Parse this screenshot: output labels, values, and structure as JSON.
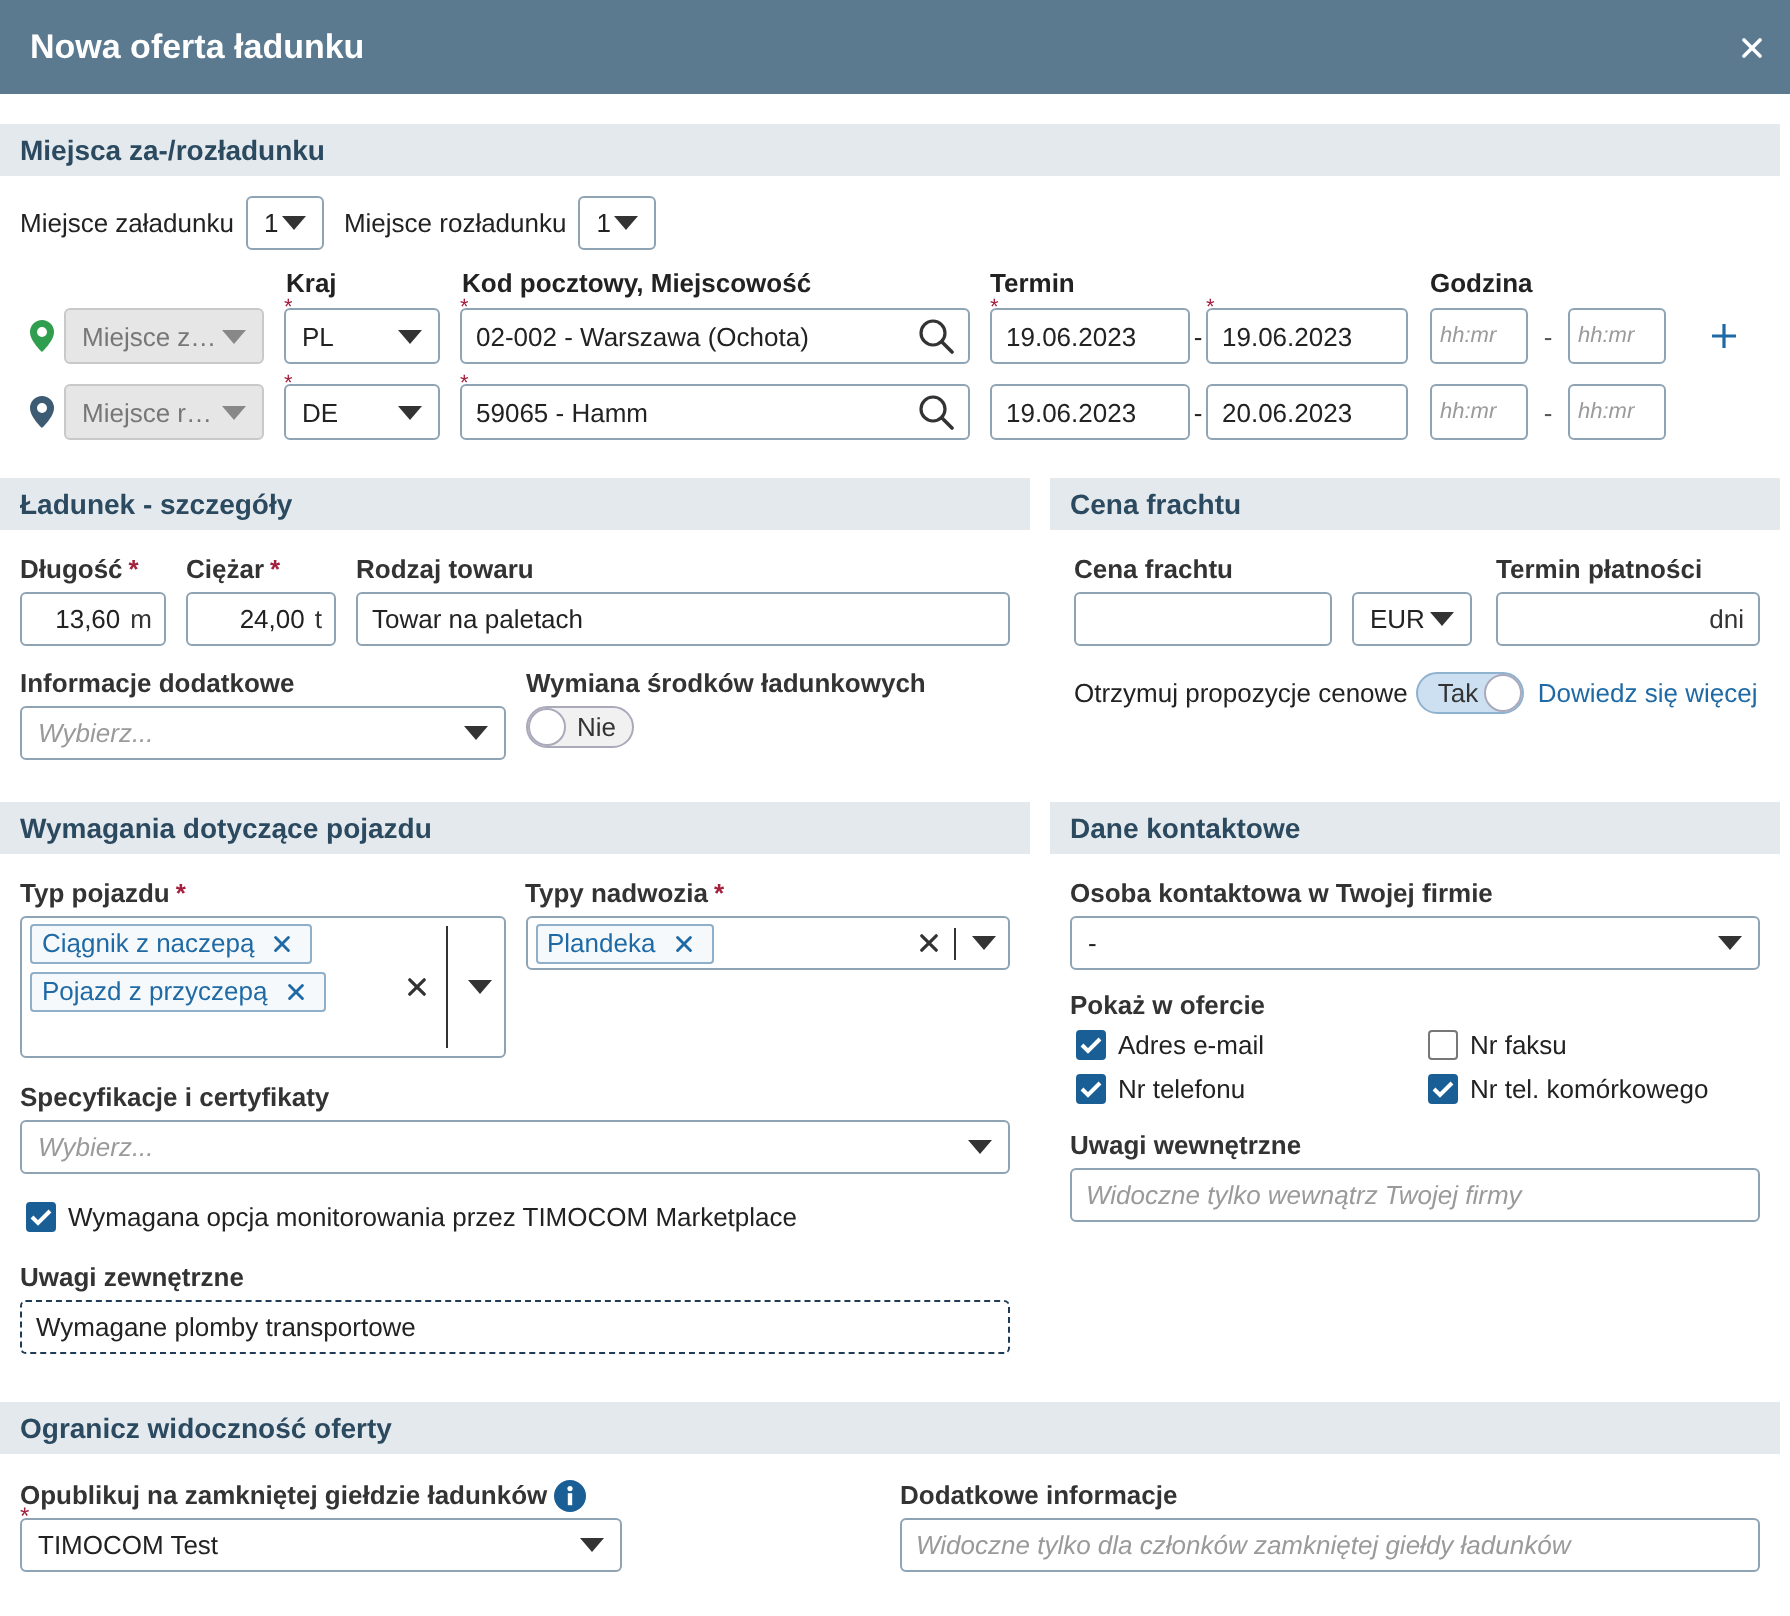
{
  "window": {
    "title": "Nowa oferta ładunku"
  },
  "places": {
    "title": "Miejsca za-/rozładunku",
    "counts": [
      {
        "label": "Miejsce załadunku",
        "value": "1"
      },
      {
        "label": "Miejsce rozładunku",
        "value": "1"
      }
    ],
    "columns": [
      "Kraj",
      "Kod pocztowy, Miejscowość",
      "Termin",
      "Godzina"
    ],
    "stops": [
      {
        "kind": "loading",
        "type": "Miejsce z…",
        "country": {
          "value": "PL",
          "required_mark": "*"
        },
        "location": {
          "value": "02-002 - Warszawa (Ochota)",
          "required_mark": "*"
        },
        "date_from": {
          "value": "19.06.2023",
          "required_mark": "*"
        },
        "date_separator": "-",
        "date_to": {
          "value": "19.06.2023",
          "required_mark": "*"
        },
        "time_from": {
          "placeholder": "hh:mr"
        },
        "time_separator": "-",
        "time_to": {
          "placeholder": "hh:mr"
        }
      },
      {
        "kind": "unloading",
        "type": "Miejsce r…",
        "country": {
          "value": "DE",
          "required_mark": "*"
        },
        "location": {
          "value": "59065 - Hamm",
          "required_mark": "*"
        },
        "date_from": {
          "value": "19.06.2023"
        },
        "date_separator": "-",
        "date_to": {
          "value": "20.06.2023"
        },
        "time_from": {
          "placeholder": "hh:mr"
        },
        "time_separator": "-",
        "time_to": {
          "placeholder": "hh:mr"
        }
      }
    ]
  },
  "cargo": {
    "title": "Ładunek - szczegóły",
    "length": {
      "label": "Długość",
      "required_mark": "*",
      "value": "13,60",
      "unit": "m"
    },
    "weight": {
      "label": "Ciężar",
      "required_mark": "*",
      "value": "24,00",
      "unit": "t"
    },
    "goods": {
      "label": "Rodzaj towaru",
      "value": "Towar na paletach"
    },
    "extra_info": {
      "label": "Informacje dodatkowe",
      "placeholder": "Wybierz..."
    },
    "exchange": {
      "label": "Wymiana środków ładunkowych",
      "on": false,
      "text": "Nie"
    }
  },
  "price": {
    "title": "Cena frachtu",
    "price": {
      "label": "Cena frachtu"
    },
    "currency": "EUR",
    "payment_term": {
      "label": "Termin płatności",
      "unit": "dni"
    },
    "proposals": {
      "label": "Otrzymuj propozycje cenowe",
      "on": true,
      "text": "Tak"
    },
    "learn_more": "Dowiedz się więcej"
  },
  "vehicle": {
    "title": "Wymagania dotyczące pojazdu",
    "vehicle_types": {
      "label": "Typ pojazdu",
      "required_mark": "*",
      "tags": [
        "Ciągnik z naczepą",
        "Pojazd z przyczepą"
      ]
    },
    "body_types": {
      "label": "Typy nadwozia",
      "required_mark": "*",
      "tags": [
        "Plandeka"
      ]
    },
    "specs": {
      "label": "Specyfikacje i certyfikaty",
      "placeholder": "Wybierz..."
    },
    "monitoring": {
      "label": "Wymagana opcja monitorowania przez TIMOCOM Marketplace",
      "checked": true
    },
    "external_notes": {
      "label": "Uwagi zewnętrzne",
      "value": "Wymagane plomby transportowe",
      "focused": true
    }
  },
  "contact": {
    "title": "Dane kontaktowe",
    "person": {
      "label": "Osoba kontaktowa w Twojej firmie",
      "value": "-"
    },
    "show_label": "Pokaż w ofercie",
    "show_options": [
      {
        "label": "Adres e-mail",
        "checked": true
      },
      {
        "label": "Nr faksu",
        "checked": false
      },
      {
        "label": "Nr telefonu",
        "checked": true
      },
      {
        "label": "Nr tel. komórkowego",
        "checked": true
      }
    ],
    "internal_notes": {
      "label": "Uwagi wewnętrzne",
      "placeholder": "Widoczne tylko wewnątrz Twojej firmy"
    }
  },
  "visibility": {
    "title": "Ogranicz widoczność oferty",
    "closed_exchange": {
      "label": "Opublikuj na zamkniętej giełdzie ładunków",
      "required_mark": "*",
      "value": "TIMOCOM Test"
    },
    "extra_info": {
      "label": "Dodatkowe informacje",
      "placeholder": "Widoczne tylko dla członków zamkniętej giełdy ładunków"
    }
  }
}
